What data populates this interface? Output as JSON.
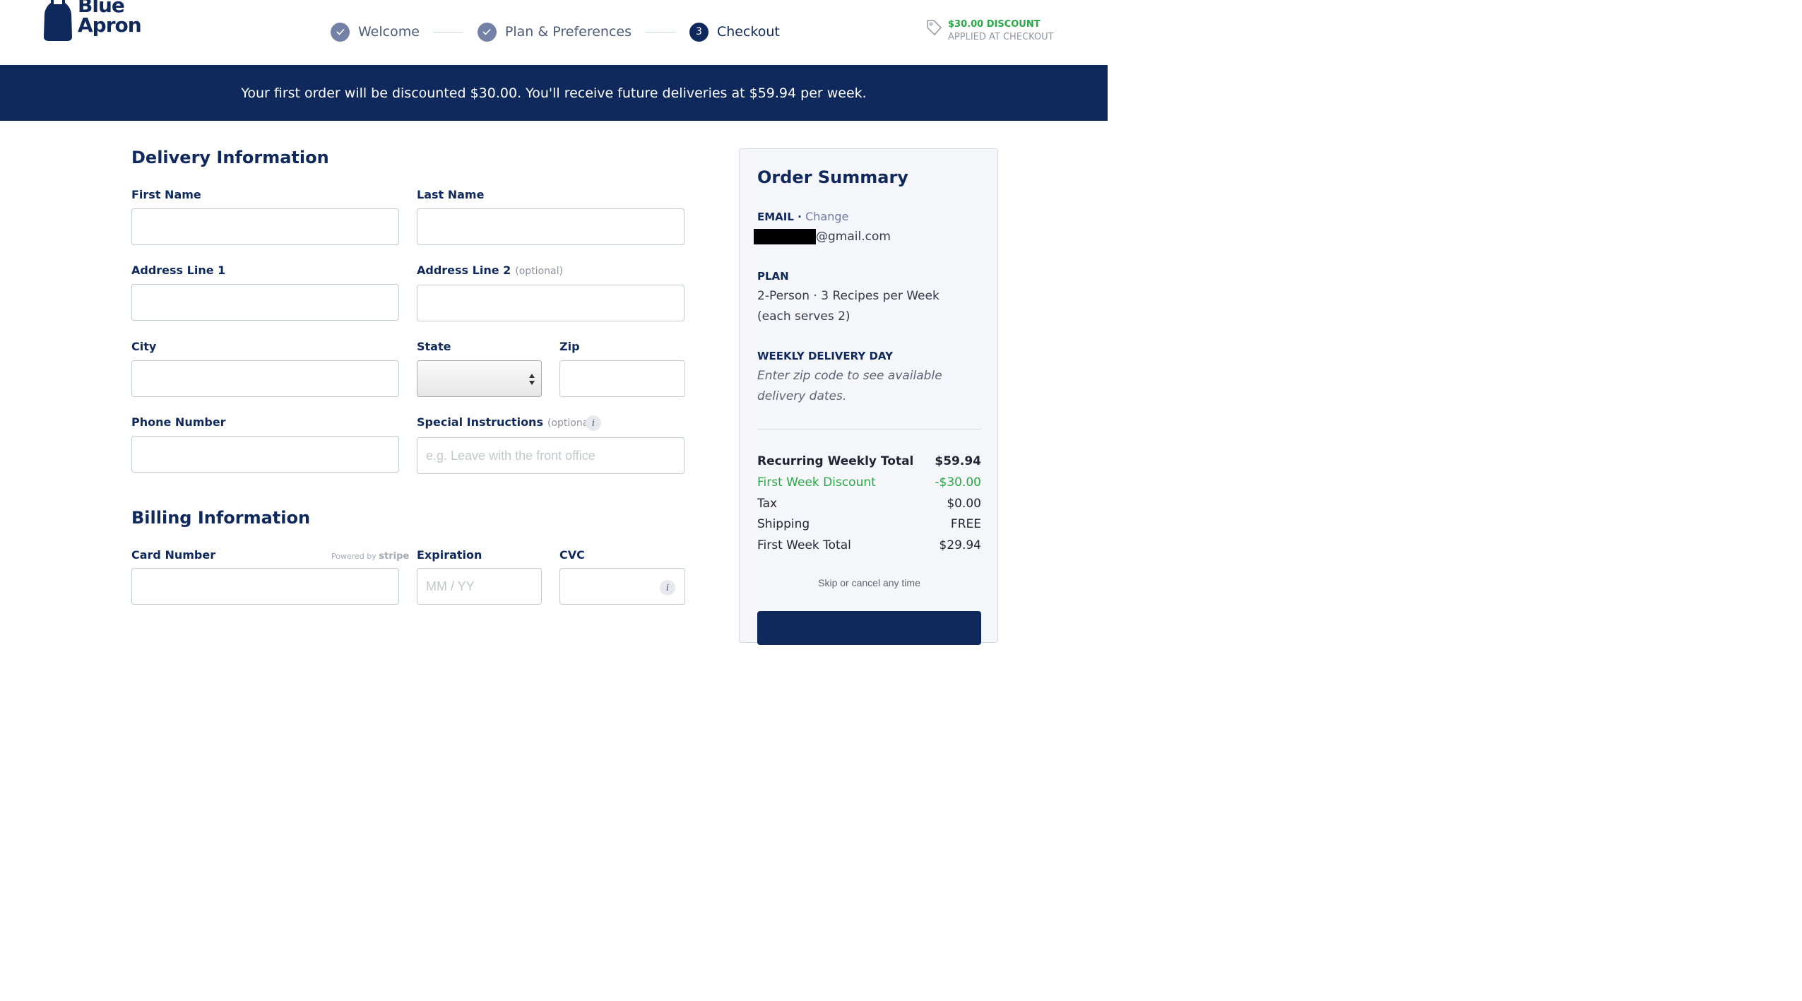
{
  "brand": {
    "name_line1": "Blue",
    "name_line2": "Apron"
  },
  "steps": [
    {
      "label": "Welcome",
      "state": "done"
    },
    {
      "label": "Plan & Preferences",
      "state": "done"
    },
    {
      "label": "Checkout",
      "state": "active",
      "number": "3"
    }
  ],
  "discount": {
    "amount": "$30.00 DISCOUNT",
    "note": "APPLIED AT CHECKOUT"
  },
  "banner": "Your first order will be discounted $30.00. You'll receive future deliveries at $59.94 per week.",
  "delivery": {
    "title": "Delivery Information",
    "first_name_label": "First Name",
    "last_name_label": "Last Name",
    "address1_label": "Address Line 1",
    "address2_label": "Address Line 2",
    "optional": "(optional)",
    "city_label": "City",
    "state_label": "State",
    "zip_label": "Zip",
    "phone_label": "Phone Number",
    "special_label": "Special Instructions",
    "special_placeholder": "e.g. Leave with the front office"
  },
  "billing": {
    "title": "Billing Information",
    "card_label": "Card Number",
    "powered_by": "Powered by",
    "stripe": "stripe",
    "expiration_label": "Expiration",
    "expiration_placeholder": "MM / YY",
    "cvc_label": "CVC"
  },
  "summary": {
    "title": "Order Summary",
    "email_label": "EMAIL",
    "email_separator": "·",
    "change_link": "Change",
    "email_value": "@gmail.com",
    "plan_label": "PLAN",
    "plan_value": "2-Person · 3 Recipes per Week (each serves 2)",
    "delivery_day_label": "WEEKLY DELIVERY DAY",
    "delivery_day_value": "Enter zip code to see available delivery dates.",
    "rows": [
      {
        "label": "Recurring Weekly Total",
        "value": "$59.94"
      },
      {
        "label": "First Week Discount",
        "value": "-$30.00"
      },
      {
        "label": "Tax",
        "value": "$0.00"
      },
      {
        "label": "Shipping",
        "value": "FREE"
      },
      {
        "label": "First Week Total",
        "value": "$29.94"
      }
    ],
    "skip_note": "Skip or cancel any time"
  },
  "colors": {
    "navy": "#10295c",
    "green": "#2aa748",
    "step_done": "#7381a6"
  }
}
